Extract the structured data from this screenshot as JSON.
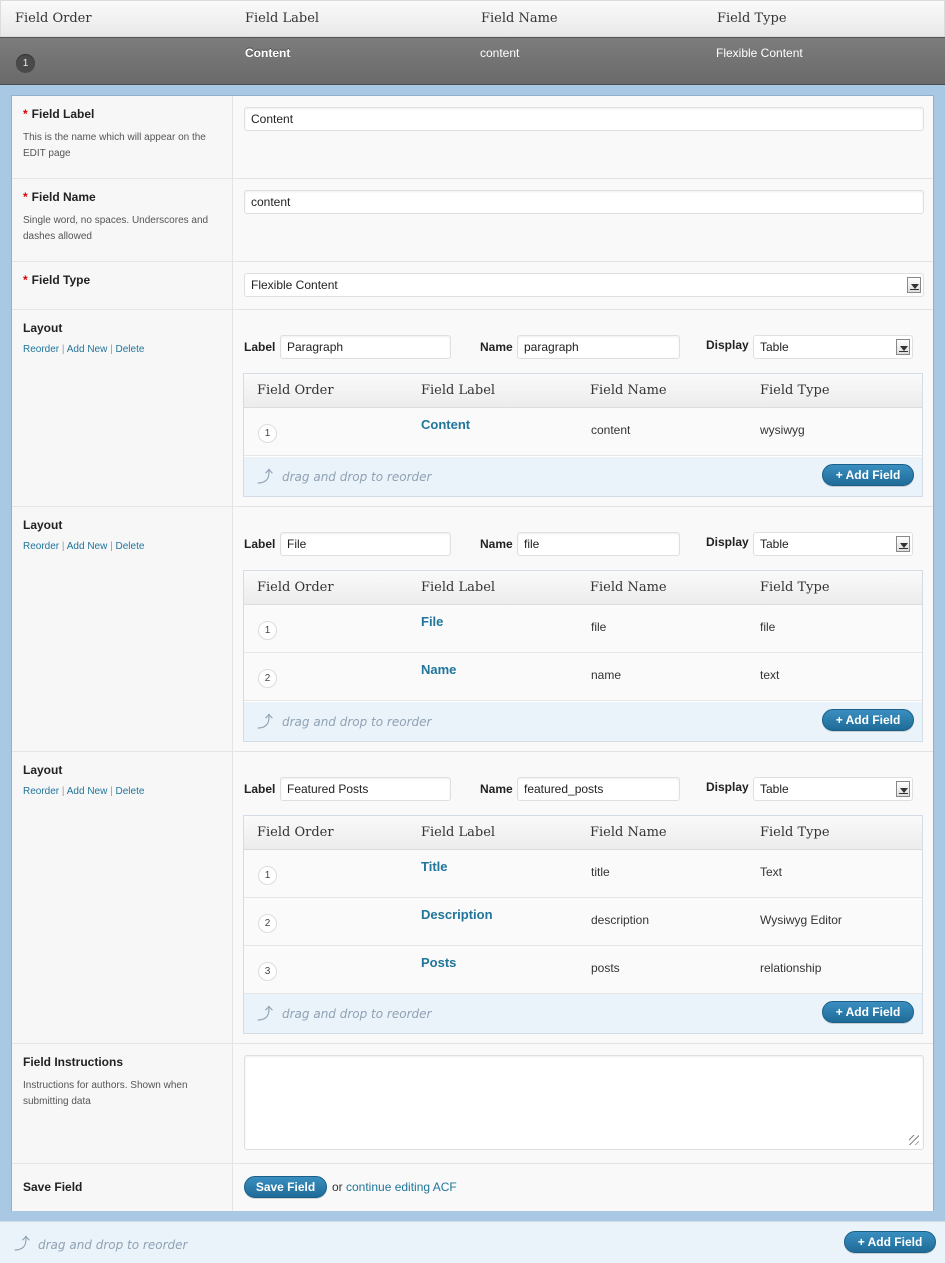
{
  "columns": {
    "order": "Field Order",
    "label": "Field Label",
    "name": "Field Name",
    "type": "Field Type"
  },
  "field": {
    "number": "1",
    "label": "Content",
    "name": "content",
    "type": "Flexible Content"
  },
  "form": {
    "label_title": "Field Label",
    "label_desc": "This is the name which will appear on the EDIT page",
    "label_value": "Content",
    "name_title": "Field Name",
    "name_desc": "Single word, no spaces. Underscores and dashes allowed",
    "name_value": "content",
    "type_title": "Field Type",
    "type_value": "Flexible Content",
    "required_mark": "*",
    "instructions_title": "Field Instructions",
    "instructions_desc": "Instructions for authors. Shown when submitting data",
    "instructions_value": "",
    "save_title": "Save Field",
    "save_button": "Save Field",
    "or_text": "or",
    "continue_link": "continue editing ACF"
  },
  "layout_common": {
    "title": "Layout",
    "reorder": "Reorder",
    "add_new": "Add New",
    "delete": "Delete",
    "sep": "|",
    "label_label": "Label",
    "name_label": "Name",
    "display_label": "Display",
    "drag_text": "drag and drop to reorder",
    "add_field": "+ Add Field"
  },
  "layouts": [
    {
      "label": "Paragraph",
      "name": "paragraph",
      "display": "Table",
      "rows": [
        {
          "num": "1",
          "label": "Content",
          "name": "content",
          "type": "wysiwyg"
        }
      ]
    },
    {
      "label": "File",
      "name": "file",
      "display": "Table",
      "rows": [
        {
          "num": "1",
          "label": "File",
          "name": "file",
          "type": "file"
        },
        {
          "num": "2",
          "label": "Name",
          "name": "name",
          "type": "text"
        }
      ]
    },
    {
      "label": "Featured Posts",
      "name": "featured_posts",
      "display": "Table",
      "rows": [
        {
          "num": "1",
          "label": "Title",
          "name": "title",
          "type": "Text"
        },
        {
          "num": "2",
          "label": "Description",
          "name": "description",
          "type": "Wysiwyg Editor"
        },
        {
          "num": "3",
          "label": "Posts",
          "name": "posts",
          "type": "relationship"
        }
      ]
    }
  ],
  "footer": {
    "drag_text": "drag and drop to reorder",
    "add_field": "+ Add Field"
  }
}
